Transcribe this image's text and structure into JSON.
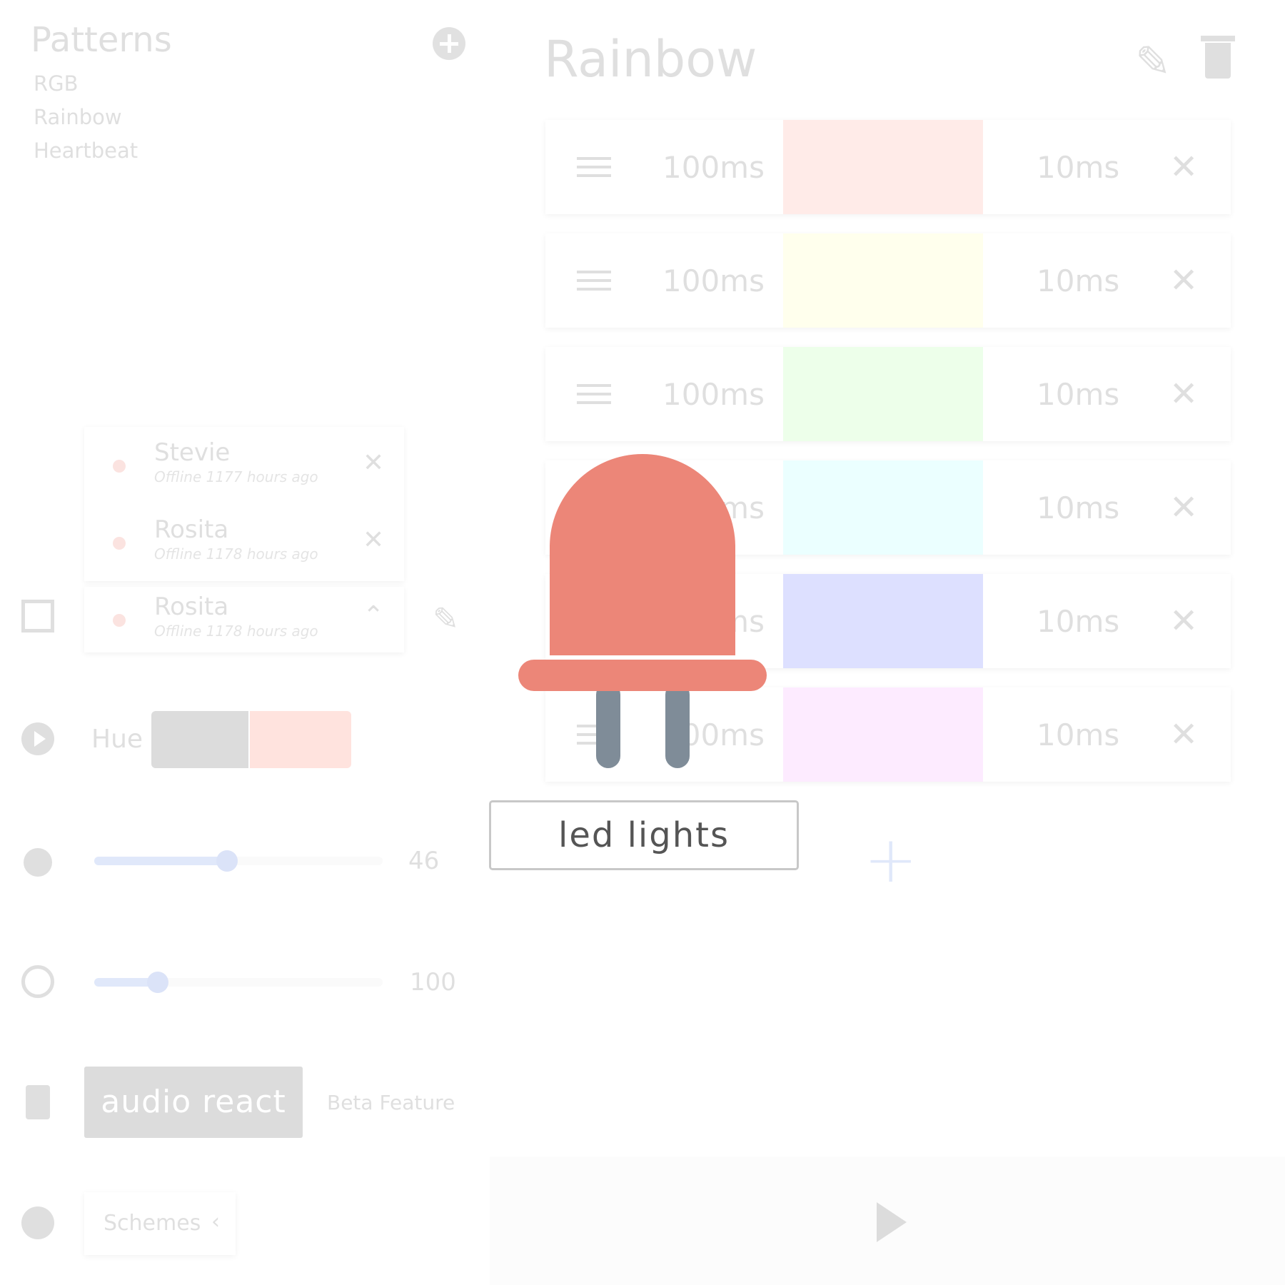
{
  "patterns": {
    "title": "Patterns",
    "items": [
      "RGB",
      "Rainbow",
      "Heartbeat"
    ]
  },
  "devices": [
    {
      "name": "Stevie",
      "status": "Offline 1177 hours ago"
    },
    {
      "name": "Rosita",
      "status": "Offline 1178 hours ago"
    },
    {
      "name": "Rosita",
      "status": "Offline 1178 hours ago"
    }
  ],
  "controls": {
    "hue_label": "Hue",
    "brightness": {
      "value": "46",
      "level": 0.46
    },
    "speed": {
      "value": "100",
      "level": 0.22
    },
    "audio_button": "audio react",
    "beta_label": "Beta Feature",
    "schemes_label": "Schemes"
  },
  "editor": {
    "title": "Rainbow",
    "steps": [
      {
        "duration": "100ms",
        "color": "#ff7f6e",
        "transition": "10ms"
      },
      {
        "duration": "100ms",
        "color": "#ffff8a",
        "transition": "10ms"
      },
      {
        "duration": "100ms",
        "color": "#8dff7a",
        "transition": "10ms"
      },
      {
        "duration": "100ms",
        "color": "#80fffb",
        "transition": "10ms"
      },
      {
        "duration": "100ms",
        "color": "#2a3dff",
        "transition": "10ms"
      },
      {
        "duration": "100ms",
        "color": "#f27dff",
        "transition": "10ms"
      }
    ]
  },
  "splash": {
    "input_value": "led lights"
  },
  "colors": {
    "accent": "#3a6fe0",
    "led_body": "#ec8678",
    "led_legs": "#7f8c98"
  }
}
